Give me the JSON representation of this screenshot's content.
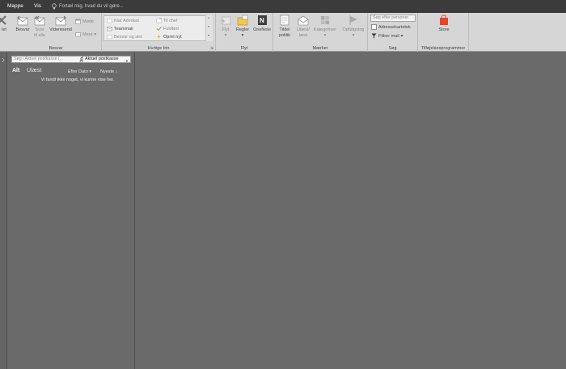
{
  "menu": {
    "tab_folder": "Mappe",
    "tab_view": "Vis",
    "tell_me": "Fortæl mig, hvad du vil gøre..."
  },
  "ribbon": {
    "delete_partial": "let",
    "respond": {
      "reply": "Besvar",
      "reply_all_line1": "Svar",
      "reply_all_line2": "til alle",
      "forward": "Videresend",
      "meeting": "Møde",
      "more": "Mere",
      "label": "Besvar"
    },
    "quick_steps": {
      "items": [
        "Klar Advokat",
        "Teammail",
        "Besvar og slet",
        "Til chef",
        "Fuldført",
        "Opret nyt"
      ],
      "label": "Hurtige trin"
    },
    "move": {
      "move": "Flyt",
      "rules": "Regler",
      "onenote": "OneNote",
      "label": "Flyt"
    },
    "tags": {
      "assign_line1": "Tildel",
      "assign_line2": "politik",
      "unread_line1": "Ulæst/",
      "unread_line2": "læst",
      "categories": "Kategoriser",
      "followup": "Opfølgning",
      "label": "Mærker"
    },
    "find": {
      "search_people_placeholder": "Søg efter personer",
      "address_book": "Adressekartotek",
      "filter_mail": "Filtrer mail",
      "label": "Søg"
    },
    "addins": {
      "store": "Store",
      "label": "Tilføjelsesprogrammer"
    }
  },
  "message_list": {
    "search_placeholder": "Søg i Aktuel postkasse (...",
    "scope": "Aktuel postkasse",
    "tab_all": "Alt",
    "tab_unread": "Ulæst",
    "sort_by": "Efter Dato",
    "sort_order": "Nyeste",
    "empty": "Vi fandt ikke noget, vi kunne vise her."
  },
  "colors": {
    "accent_store": "#e8432d",
    "ribbon_bg": "#d6d6d6",
    "titlebar_bg": "#3b3b3b",
    "pane_bg": "#6a6a6a"
  }
}
